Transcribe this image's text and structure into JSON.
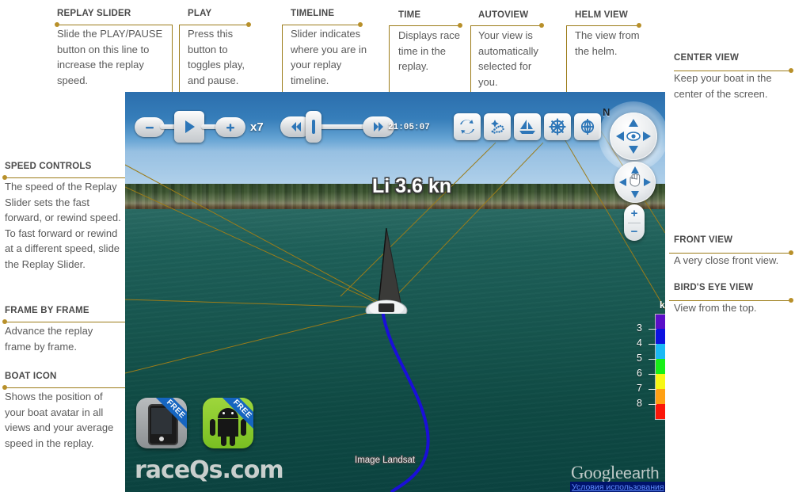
{
  "annotations": [
    {
      "key": "replay_slider",
      "title": "REPLAY SLIDER",
      "body": "Slide the PLAY/PAUSE button on this line to increase the replay speed."
    },
    {
      "key": "play",
      "title": "PLAY",
      "body": "Press this button to toggles play, and pause."
    },
    {
      "key": "timeline",
      "title": "TIMELINE",
      "body": "Slider indicates where you are in your replay timeline."
    },
    {
      "key": "time",
      "title": "TIME",
      "body": "Displays race time in the replay."
    },
    {
      "key": "autoview",
      "title": "AUTOVIEW",
      "body": "Your view is automatically selected for you."
    },
    {
      "key": "helm_view",
      "title": "HELM VIEW",
      "body": "The view from the helm."
    },
    {
      "key": "center_view",
      "title": "CENTER VIEW",
      "body": "Keep your boat in the center of the screen."
    },
    {
      "key": "speed_controls",
      "title": "SPEED CONTROLS",
      "body": "The speed of the Replay Slider sets the fast forward, or rewind speed.  To fast forward or rewind at a different speed, slide the Replay Slider."
    },
    {
      "key": "frame_by_frame",
      "title": "FRAME BY FRAME",
      "body": "Advance the replay frame by frame."
    },
    {
      "key": "boat_icon",
      "title": "BOAT ICON",
      "body": "Shows the position of your boat avatar in all views and your average speed in the replay."
    },
    {
      "key": "front_view",
      "title": "FRONT VIEW",
      "body": "A very close front view."
    },
    {
      "key": "birds_eye_view",
      "title": "BIRD'S EYE VIEW",
      "body": "View from the top."
    }
  ],
  "toolbar": {
    "speed_decrease_icon": "minus-icon",
    "play_icon": "play-icon",
    "speed_increase_icon": "plus-icon",
    "speed_multiplier": "x7",
    "step_back_icon": "double-chevron-left-icon",
    "timeline_handle_icon": "slider-handle-icon",
    "step_forward_icon": "double-chevron-right-icon",
    "race_time": "21:05:07",
    "view_buttons": [
      {
        "key": "autoview",
        "icon": "sync-arrows-icon",
        "label": "Autoview"
      },
      {
        "key": "birds_eye_view",
        "icon": "track-dots-icon",
        "label": "Bird's Eye View"
      },
      {
        "key": "helm_view",
        "icon": "sailboat-icon",
        "label": "Helm View"
      },
      {
        "key": "front_view",
        "icon": "ships-wheel-icon",
        "label": "Front View"
      },
      {
        "key": "center_view",
        "icon": "crosshair-globe-icon",
        "label": "Center View"
      }
    ]
  },
  "navigation": {
    "compass_label": "N",
    "look_joystick_icon": "eye-icon",
    "pan_joystick_icon": "hand-icon",
    "zoom_in_label": "+",
    "zoom_out_label": "−"
  },
  "map": {
    "boat_label": "Li 3.6 kn",
    "imagery_attribution": "Image Landsat",
    "brand_google": "Google",
    "brand_earth": "earth",
    "terms_link": "Условия использования"
  },
  "legend": {
    "unit": "kn",
    "ticks": [
      "3",
      "4",
      "5",
      "6",
      "7",
      "8"
    ],
    "colors": [
      "#5a0fc8",
      "#0c12e0",
      "#1bb9f5",
      "#18ef18",
      "#f7f715",
      "#ffa013",
      "#fb1709"
    ]
  },
  "footer": {
    "ios_badge": "FREE",
    "android_badge": "FREE",
    "site_name": "raceQs.com"
  }
}
